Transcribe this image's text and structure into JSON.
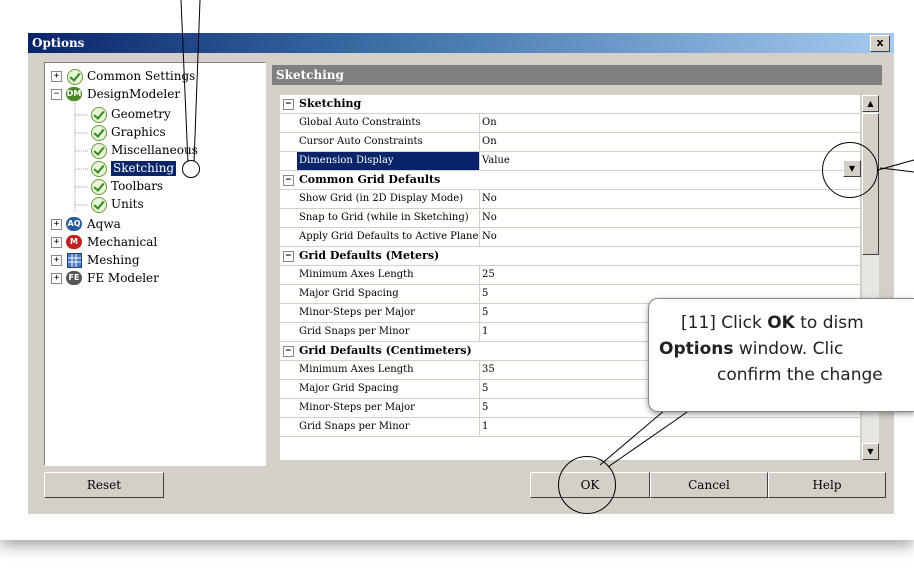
{
  "window": {
    "title": "Options",
    "close_label": "x"
  },
  "tree": {
    "items": [
      {
        "label": "Common Settings",
        "expander": "+",
        "icon": "check-icon"
      },
      {
        "label": "DesignModeler",
        "expander": "−",
        "icon": "dm-icon",
        "badge": "DM"
      },
      {
        "label": "Geometry",
        "icon": "check-icon"
      },
      {
        "label": "Graphics",
        "icon": "check-icon"
      },
      {
        "label": "Miscellaneous",
        "icon": "check-icon"
      },
      {
        "label": "Sketching",
        "icon": "check-icon",
        "selected": true
      },
      {
        "label": "Toolbars",
        "icon": "check-icon"
      },
      {
        "label": "Units",
        "icon": "check-icon"
      },
      {
        "label": "Aqwa",
        "expander": "+",
        "icon": "aqwa-icon",
        "badge": "AQ"
      },
      {
        "label": "Mechanical",
        "expander": "+",
        "icon": "mechanical-icon",
        "badge": "M"
      },
      {
        "label": "Meshing",
        "expander": "+",
        "icon": "meshing-icon"
      },
      {
        "label": "FE Modeler",
        "expander": "+",
        "icon": "fe-modeler-icon",
        "badge": "FE"
      }
    ]
  },
  "panel": {
    "title": "Sketching"
  },
  "grid": {
    "rows": [
      {
        "type": "header",
        "label": "Sketching"
      },
      {
        "label": "Global Auto Constraints",
        "value": "On"
      },
      {
        "label": "Cursor Auto Constraints",
        "value": "On"
      },
      {
        "label": "Dimension Display",
        "value": "Value",
        "selected": true
      },
      {
        "type": "header",
        "label": "Common Grid Defaults"
      },
      {
        "label": "Show Grid (in 2D Display Mode)",
        "value": "No"
      },
      {
        "label": "Snap to Grid (while in Sketching)",
        "value": "No"
      },
      {
        "label": "Apply Grid Defaults to Active Plane",
        "value": "No"
      },
      {
        "type": "header",
        "label": "Grid Defaults (Meters)"
      },
      {
        "label": "Minimum Axes Length",
        "value": "25"
      },
      {
        "label": "Major Grid Spacing",
        "value": "5"
      },
      {
        "label": "Minor-Steps per Major",
        "value": "5"
      },
      {
        "label": "Grid Snaps per Minor",
        "value": "1"
      },
      {
        "type": "header",
        "label": "Grid Defaults (Centimeters)"
      },
      {
        "label": "Minimum Axes Length",
        "value": "35"
      },
      {
        "label": "Major Grid Spacing",
        "value": "5"
      },
      {
        "label": "Minor-Steps per Major",
        "value": "5"
      },
      {
        "label": "Grid Snaps per Minor",
        "value": "1"
      }
    ]
  },
  "buttons": {
    "reset": "Reset",
    "ok": "OK",
    "cancel": "Cancel",
    "help": "Help"
  },
  "callout": {
    "line1_prefix": "[11] Click ",
    "line1_bold": "OK",
    "line1_suffix": " to dism",
    "line2_bold": "Options",
    "line2_suffix": " window.  Clic",
    "line3": "confirm the change"
  },
  "colors": {
    "selection": "#0a246a",
    "dialog_bg": "#d4d0c8",
    "title_gradient_start": "#0a246a"
  }
}
